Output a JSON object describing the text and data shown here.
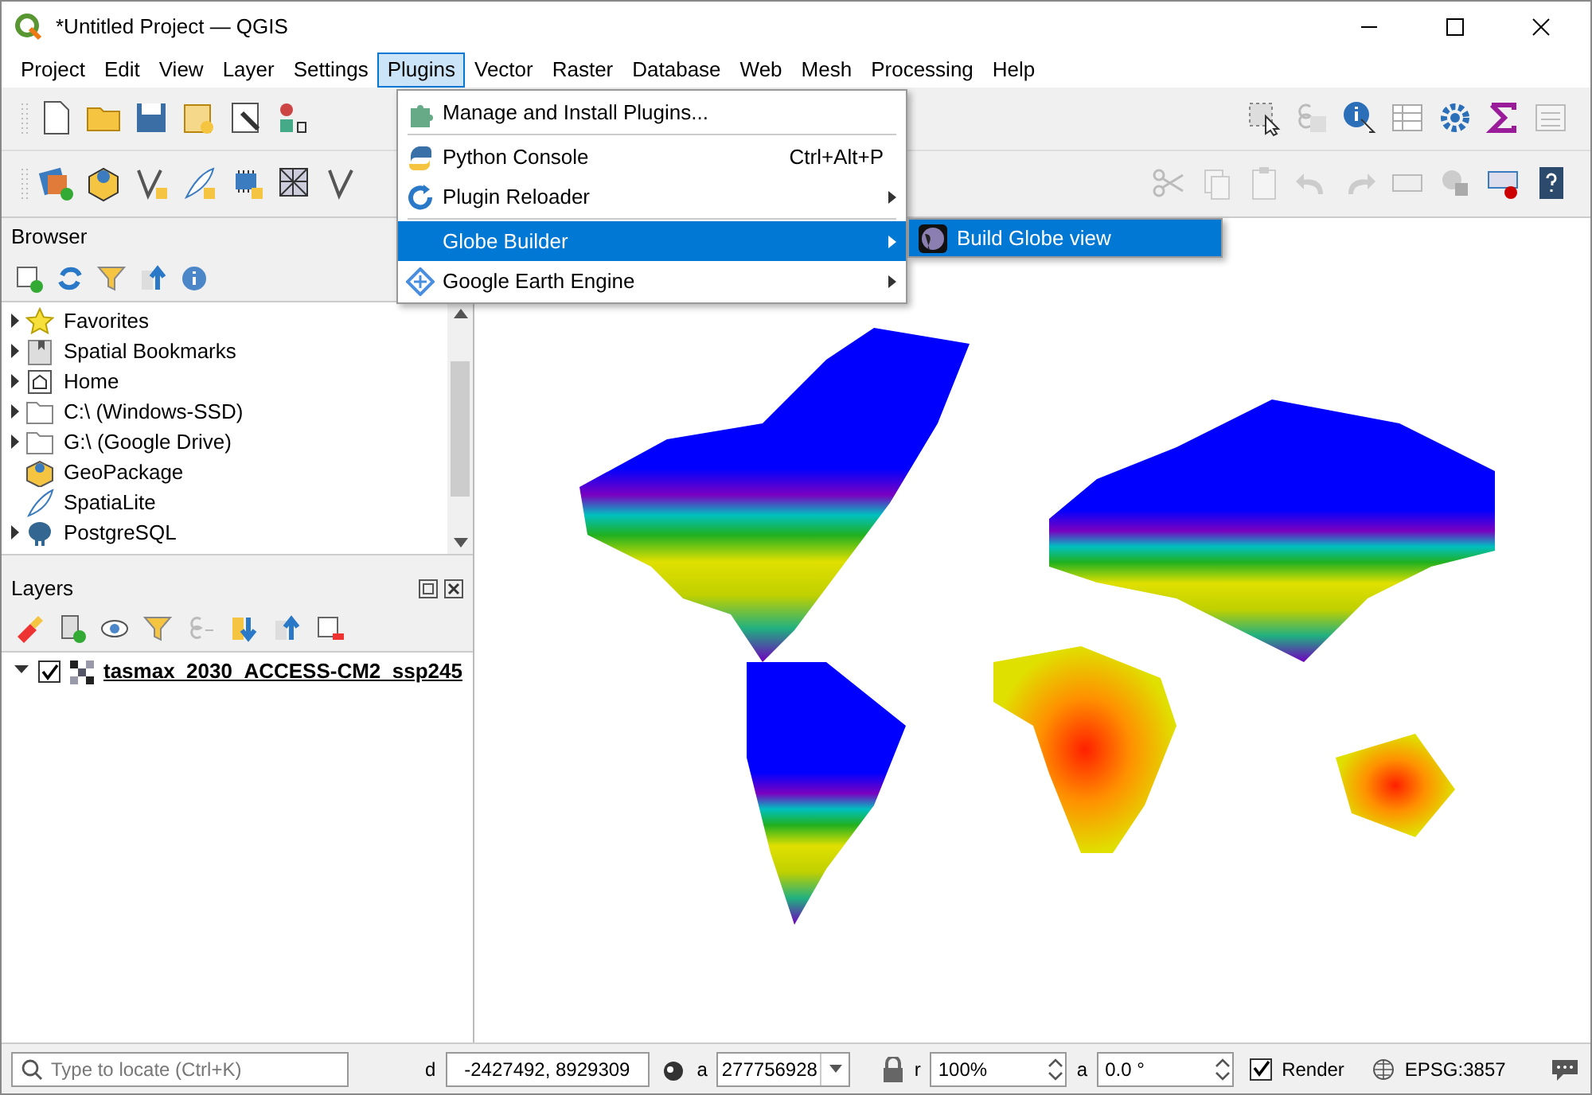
{
  "window": {
    "title": "*Untitled Project — QGIS"
  },
  "menu_bar": [
    {
      "label": "Project",
      "selected": false
    },
    {
      "label": "Edit",
      "selected": false
    },
    {
      "label": "View",
      "selected": false
    },
    {
      "label": "Layer",
      "selected": false
    },
    {
      "label": "Settings",
      "selected": false
    },
    {
      "label": "Plugins",
      "selected": true
    },
    {
      "label": "Vector",
      "selected": false
    },
    {
      "label": "Raster",
      "selected": false
    },
    {
      "label": "Database",
      "selected": false
    },
    {
      "label": "Web",
      "selected": false
    },
    {
      "label": "Mesh",
      "selected": false
    },
    {
      "label": "Processing",
      "selected": false
    },
    {
      "label": "Help",
      "selected": false
    }
  ],
  "plugins_menu": [
    {
      "kind": "item",
      "label": "Manage and Install Plugins...",
      "submenu": false,
      "selected": false
    },
    {
      "kind": "separator"
    },
    {
      "kind": "item",
      "label": "Python Console",
      "shortcut": "Ctrl+Alt+P",
      "submenu": false,
      "selected": false
    },
    {
      "kind": "item",
      "label": "Plugin Reloader",
      "submenu": true,
      "selected": false
    },
    {
      "kind": "separator"
    },
    {
      "kind": "item",
      "label": "Globe Builder",
      "submenu": true,
      "selected": true
    },
    {
      "kind": "item",
      "label": "Google Earth Engine",
      "submenu": true,
      "selected": false
    }
  ],
  "submenu": [
    {
      "label": "Build Globe view",
      "selected": true
    }
  ],
  "browser": {
    "title": "Browser",
    "items": [
      {
        "label": "Favorites",
        "expandable": true
      },
      {
        "label": "Spatial Bookmarks",
        "expandable": true
      },
      {
        "label": "Home",
        "expandable": true
      },
      {
        "label": "C:\\ (Windows-SSD)",
        "expandable": true
      },
      {
        "label": "G:\\ (Google Drive)",
        "expandable": true
      },
      {
        "label": "GeoPackage",
        "expandable": false
      },
      {
        "label": "SpatiaLite",
        "expandable": false
      },
      {
        "label": "PostgreSQL",
        "expandable": true
      }
    ]
  },
  "layers": {
    "title": "Layers",
    "items": [
      {
        "label": "tasmax_2030_ACCESS-CM2_ssp245",
        "checked": true,
        "expanded": true
      }
    ]
  },
  "status_bar": {
    "locate_placeholder": "Type to locate (Ctrl+K)",
    "coordinate_label": "d",
    "coordinate": "-2427492, 8929309",
    "scale_label": "a",
    "scale": "277756928",
    "magnifier_label": "r",
    "magnifier": "100%",
    "rotation_label": "a",
    "rotation": "0.0 °",
    "render": {
      "label": "Render",
      "checked": true
    },
    "crs": "EPSG:3857"
  }
}
